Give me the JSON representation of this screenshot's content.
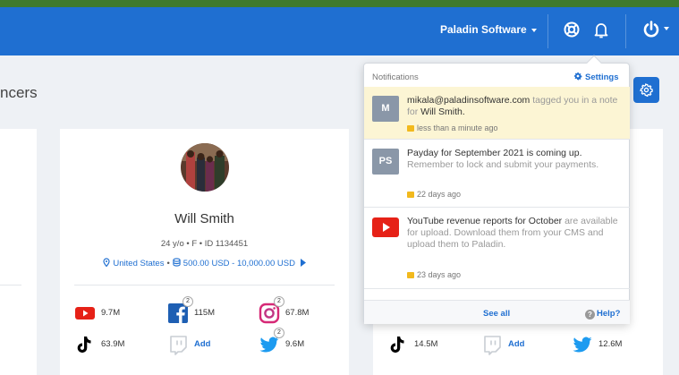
{
  "navbar": {
    "brand": "Paladin Software",
    "icons": {
      "help": "lifebuoy-icon",
      "notifications": "bell-icon",
      "power": "power-icon"
    }
  },
  "page": {
    "title": "ncers",
    "settings_icon": "gear-icon"
  },
  "notifications": {
    "title": "Notifications",
    "settings_label": "Settings",
    "items": [
      {
        "avatar": "M",
        "actor": "mikala@paladinsoftware.com",
        "text_1": " tagged you in a note for ",
        "subject": "Will Smith",
        "text_2": ".",
        "time": "less than a minute ago",
        "unread": true
      },
      {
        "avatar": "PS",
        "headline": "Payday for September 2021 is coming up.",
        "detail": " Remember to lock and submit your payments.",
        "time": "22 days ago",
        "unread": false
      },
      {
        "avatar_icon": "youtube-icon",
        "headline": "YouTube revenue reports for October",
        "detail": " are available for upload. Download them from your CMS and upload them to Paladin.",
        "time": "23 days ago",
        "unread": false
      }
    ],
    "see_all": "See all",
    "help": "Help?"
  },
  "influencer": {
    "name": "Will Smith",
    "meta": "24 y/o • F • ID 1134451",
    "location": "United States",
    "budget": "500.00 USD - 10,000.00 USD",
    "stats": {
      "youtube": "9.7M",
      "facebook": "115M",
      "facebook_badge": "2",
      "instagram": "67.8M",
      "instagram_badge": "2",
      "tiktok": "63.9M",
      "twitch": "Add",
      "twitter": "9.6M",
      "twitter_badge": "2"
    }
  },
  "right_card": {
    "tiktok": "14.5M",
    "twitch": "Add",
    "twitter": "12.6M"
  },
  "colors": {
    "primary": "#1f6fd1",
    "unread": "#fcf5d4",
    "youtube": "#e62117",
    "twitter": "#1d9bf0",
    "instagram": "#d62976"
  }
}
